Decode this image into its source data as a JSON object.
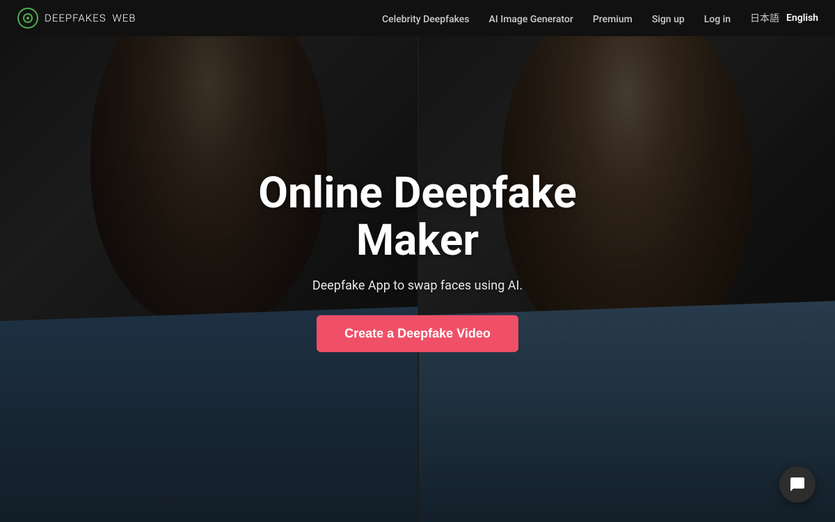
{
  "navbar": {
    "logo_text": "DEEPFAKES",
    "logo_sub": "WEB",
    "links": [
      {
        "label": "Celebrity Deepfakes",
        "id": "celebrity-deepfakes"
      },
      {
        "label": "AI Image Generator",
        "id": "ai-image-generator"
      },
      {
        "label": "Premium",
        "id": "premium"
      },
      {
        "label": "Sign up",
        "id": "sign-up"
      },
      {
        "label": "Log in",
        "id": "log-in"
      }
    ],
    "lang_ja": "日本語",
    "lang_en": "English"
  },
  "hero": {
    "title_line1": "Online Deepfake",
    "title_line2": "Maker",
    "subtitle": "Deepfake App to swap faces using AI.",
    "cta_label": "Create a Deepfake Video"
  },
  "chat": {
    "icon": "chat-bubble-icon"
  },
  "colors": {
    "cta_bg": "#f05067",
    "navbar_bg": "#111111"
  }
}
